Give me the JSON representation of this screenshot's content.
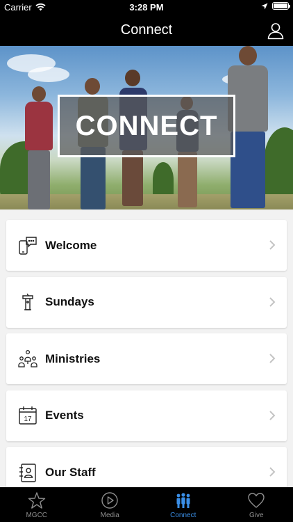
{
  "status_bar": {
    "carrier": "Carrier",
    "time": "3:28 PM"
  },
  "nav": {
    "title": "Connect",
    "profile_icon": "person-icon"
  },
  "hero": {
    "overlay_text": "CONNECT"
  },
  "menu": {
    "items": [
      {
        "label": "Welcome",
        "icon": "welcome-chat-icon"
      },
      {
        "label": "Sundays",
        "icon": "podium-icon"
      },
      {
        "label": "Ministries",
        "icon": "people-group-icon"
      },
      {
        "label": "Events",
        "icon": "calendar-icon",
        "calendar_day": "17"
      },
      {
        "label": "Our Staff",
        "icon": "contact-book-icon"
      }
    ]
  },
  "tabs": [
    {
      "label": "MGCC",
      "icon": "star-icon",
      "active": false
    },
    {
      "label": "Media",
      "icon": "play-icon",
      "active": false
    },
    {
      "label": "Connect",
      "icon": "group-icon",
      "active": true
    },
    {
      "label": "Give",
      "icon": "heart-icon",
      "active": false
    }
  ],
  "colors": {
    "accent": "#3a8ee6",
    "bar_background": "#000000",
    "inactive": "#8e8e8e"
  }
}
